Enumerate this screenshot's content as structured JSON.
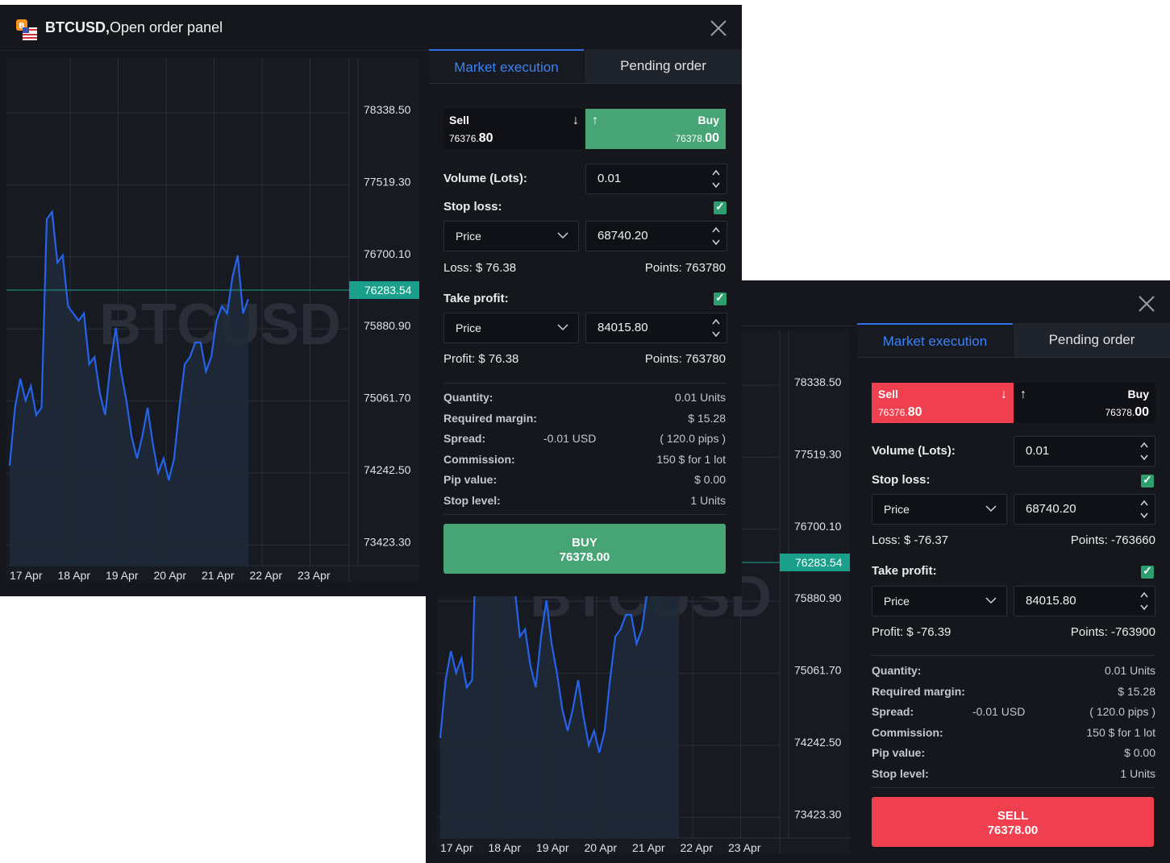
{
  "colors": {
    "buy_green": "#46a475",
    "sell_red": "#f03f4f",
    "accent_blue": "#2f6fe8",
    "line_blue": "#2563eb",
    "price_tag": "#1aa08a"
  },
  "panel1": {
    "title_symbol": "BTCUSD,",
    "title_rest": "Open order panel",
    "icons": {
      "logo": "bitcoin-usd-flag-icon",
      "close": "close-icon"
    },
    "chart": {
      "watermark": "BTCUSD",
      "y_labels": [
        "78338.50",
        "77519.30",
        "76700.10",
        "75880.90",
        "75061.70",
        "74242.50",
        "73423.30"
      ],
      "x_labels": [
        "17 Apr",
        "18 Apr",
        "19 Apr",
        "20 Apr",
        "21 Apr",
        "22 Apr",
        "23 Apr"
      ],
      "current_price": "76283.54"
    },
    "tabs": {
      "market": "Market execution",
      "pending": "Pending order"
    },
    "sell": {
      "label": "Sell",
      "price_small": "76376.",
      "price_big": "80"
    },
    "buy": {
      "label": "Buy",
      "price_small": "76378.",
      "price_big": "00"
    },
    "volume": {
      "label": "Volume (Lots):",
      "value": "0.01"
    },
    "stop_loss": {
      "label": "Stop loss:",
      "mode": "Price",
      "value": "68740.20",
      "result": "Loss: $ 76.38",
      "points": "Points: 763780"
    },
    "take_profit": {
      "label": "Take profit:",
      "mode": "Price",
      "value": "84015.80",
      "result": "Profit: $ 76.38",
      "points": "Points: 763780"
    },
    "details": {
      "quantity": {
        "k": "Quantity:",
        "v": "0.01 Units"
      },
      "margin": {
        "k": "Required margin:",
        "v": "$ 15.28"
      },
      "spread": {
        "k": "Spread:",
        "m": "-0.01 USD",
        "v": "( 120.0 pips )"
      },
      "commission": {
        "k": "Commission:",
        "v": "150 $ for 1 lot"
      },
      "pip": {
        "k": "Pip value:",
        "v": "$ 0.00"
      },
      "stop_level": {
        "k": "Stop level:",
        "v": "1 Units"
      }
    },
    "action": {
      "label": "BUY",
      "price": "76378.00"
    }
  },
  "panel2": {
    "chart": {
      "watermark": "BTCUSD",
      "y_labels": [
        "78338.50",
        "77519.30",
        "76700.10",
        "75880.90",
        "75061.70",
        "74242.50",
        "73423.30"
      ],
      "x_labels": [
        "17 Apr",
        "18 Apr",
        "19 Apr",
        "20 Apr",
        "21 Apr",
        "22 Apr",
        "23 Apr"
      ],
      "current_price": "76283.54"
    },
    "tabs": {
      "market": "Market execution",
      "pending": "Pending order"
    },
    "sell": {
      "label": "Sell",
      "price_small": "76376.",
      "price_big": "80"
    },
    "buy": {
      "label": "Buy",
      "price_small": "76378.",
      "price_big": "00"
    },
    "volume": {
      "label": "Volume (Lots):",
      "value": "0.01"
    },
    "stop_loss": {
      "label": "Stop loss:",
      "mode": "Price",
      "value": "68740.20",
      "result": "Loss: $ -76.37",
      "points": "Points: -763660"
    },
    "take_profit": {
      "label": "Take profit:",
      "mode": "Price",
      "value": "84015.80",
      "result": "Profit: $ -76.39",
      "points": "Points: -763900"
    },
    "details": {
      "quantity": {
        "k": "Quantity:",
        "v": "0.01 Units"
      },
      "margin": {
        "k": "Required margin:",
        "v": "$ 15.28"
      },
      "spread": {
        "k": "Spread:",
        "m": "-0.01 USD",
        "v": "( 120.0 pips )"
      },
      "commission": {
        "k": "Commission:",
        "v": "150 $ for 1 lot"
      },
      "pip": {
        "k": "Pip value:",
        "v": "$ 0.00"
      },
      "stop_level": {
        "k": "Stop level:",
        "v": "1 Units"
      }
    },
    "action": {
      "label": "SELL",
      "price": "76378.00"
    }
  }
}
